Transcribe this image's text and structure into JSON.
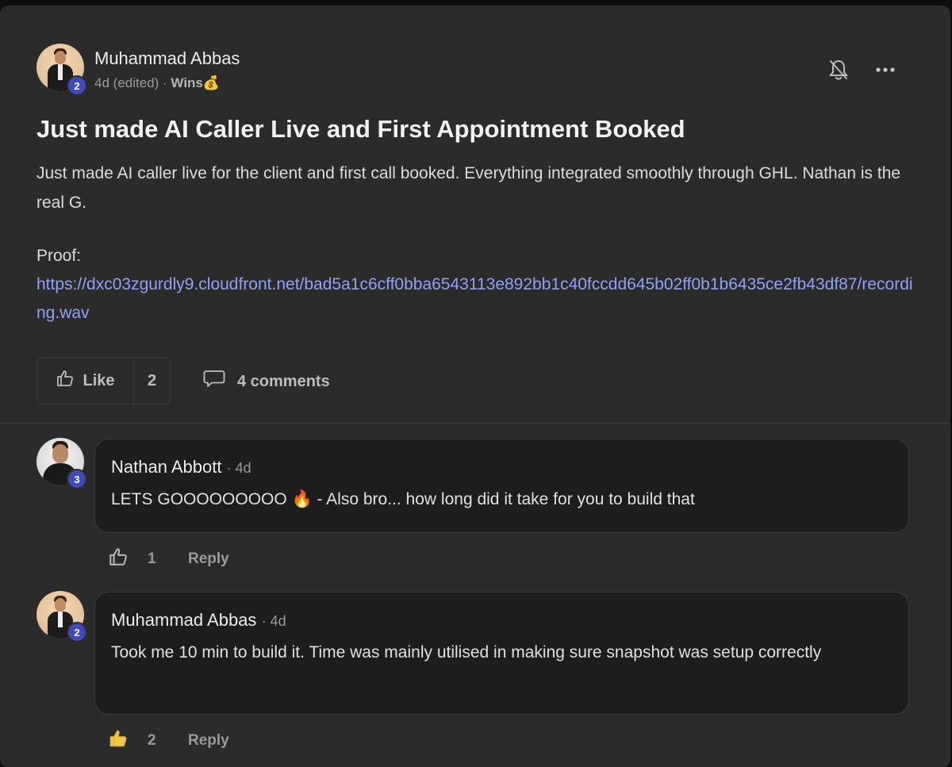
{
  "post": {
    "author": "Muhammad Abbas",
    "author_level": "2",
    "time": "4d (edited)",
    "separator": "·",
    "category": "Wins💰",
    "title": "Just made AI Caller Live and First Appointment Booked",
    "body": "Just made AI caller live for the client and first call booked. Everything integrated smoothly through GHL. Nathan is the real G.",
    "proof_label": "Proof:",
    "link": "https://dxc03zgurdly9.cloudfront.net/bad5a1c6cff0bba6543113e892bb1c40fccdd645b02ff0b1b6435ce2fb43df87/recording.wav",
    "like_label": "Like",
    "like_count": "2",
    "comments_label": "4 comments",
    "icons": {
      "bell": "bell-off-icon",
      "more": "more-dots-icon",
      "like": "thumbs-up-icon",
      "comment": "comment-bubble-icon"
    }
  },
  "comments": [
    {
      "author": "Nathan Abbott",
      "author_level": "3",
      "time": "· 4d",
      "text": "LETS GOOOOOOOOO 🔥 - Also bro... how long did it take for you to build that",
      "like_count": "1",
      "reply_label": "Reply",
      "liked": false
    },
    {
      "author": "Muhammad Abbas",
      "author_level": "2",
      "time": "· 4d",
      "text": "Took me 10 min to build it. Time was mainly utilised in making sure snapshot was setup correctly",
      "like_count": "2",
      "reply_label": "Reply",
      "liked": true
    }
  ],
  "colors": {
    "background": "#2b2b2b",
    "link": "#8ea3f5",
    "level_badge": "#3f4bb8",
    "liked_thumb": "#f2c84b"
  }
}
